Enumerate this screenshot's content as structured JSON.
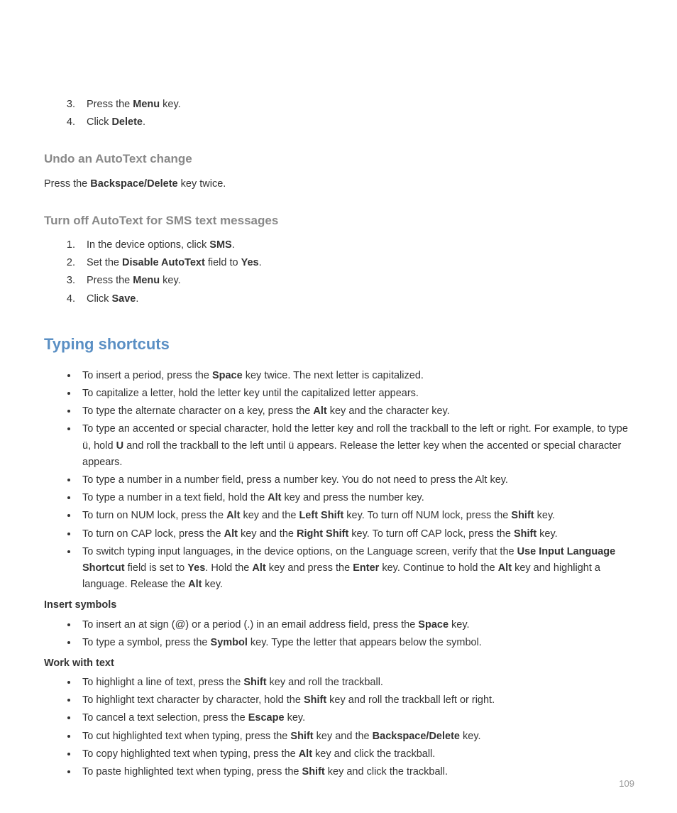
{
  "introList": {
    "start": 3,
    "items": [
      {
        "pre": "Press the ",
        "b": "Menu",
        "post": " key."
      },
      {
        "pre": "Click ",
        "b": "Delete",
        "post": "."
      }
    ]
  },
  "undo": {
    "heading": "Undo an AutoText change",
    "text_pre": "Press the ",
    "text_b": "Backspace/Delete",
    "text_post": " key twice."
  },
  "turnoff": {
    "heading": "Turn off AutoText for SMS text messages",
    "items": [
      {
        "segments": [
          {
            "t": "In the device options, click "
          },
          {
            "b": "SMS"
          },
          {
            "t": "."
          }
        ]
      },
      {
        "segments": [
          {
            "t": "Set the "
          },
          {
            "b": "Disable AutoText"
          },
          {
            "t": " field to "
          },
          {
            "b": "Yes"
          },
          {
            "t": "."
          }
        ]
      },
      {
        "segments": [
          {
            "t": "Press the "
          },
          {
            "b": "Menu"
          },
          {
            "t": " key."
          }
        ]
      },
      {
        "segments": [
          {
            "t": "Click "
          },
          {
            "b": "Save"
          },
          {
            "t": "."
          }
        ]
      }
    ]
  },
  "typing": {
    "heading": "Typing shortcuts",
    "mainList": [
      {
        "segments": [
          {
            "t": "To insert a period, press the "
          },
          {
            "b": "Space"
          },
          {
            "t": " key twice. The next letter is capitalized."
          }
        ]
      },
      {
        "segments": [
          {
            "t": "To capitalize a letter, hold the letter key until the capitalized letter appears."
          }
        ]
      },
      {
        "segments": [
          {
            "t": "To type the alternate character on a key, press the "
          },
          {
            "b": "Alt"
          },
          {
            "t": " key and the character key."
          }
        ]
      },
      {
        "segments": [
          {
            "t": "To type an accented or special character, hold the letter key and roll the trackball to the left or right. For example, to type ü, hold "
          },
          {
            "b": "U"
          },
          {
            "t": " and roll the trackball to the left until ü appears. Release the letter key when the accented or special character appears."
          }
        ]
      },
      {
        "segments": [
          {
            "t": "To type a number in a number field, press a number key. You do not need to press the Alt key."
          }
        ]
      },
      {
        "segments": [
          {
            "t": "To type a number in a text field, hold the "
          },
          {
            "b": "Alt"
          },
          {
            "t": " key and press the number key."
          }
        ]
      },
      {
        "segments": [
          {
            "t": "To turn on NUM lock, press the "
          },
          {
            "b": "Alt"
          },
          {
            "t": " key and the "
          },
          {
            "b": "Left Shift"
          },
          {
            "t": " key. To turn off NUM lock, press the "
          },
          {
            "b": "Shift"
          },
          {
            "t": " key."
          }
        ]
      },
      {
        "segments": [
          {
            "t": "To turn on CAP lock, press the "
          },
          {
            "b": "Alt"
          },
          {
            "t": " key and the "
          },
          {
            "b": "Right Shift"
          },
          {
            "t": " key. To turn off CAP lock, press the "
          },
          {
            "b": "Shift"
          },
          {
            "t": " key."
          }
        ]
      },
      {
        "segments": [
          {
            "t": "To switch typing input languages, in the device options, on the Language screen, verify that the "
          },
          {
            "b": "Use Input Language Shortcut"
          },
          {
            "t": " field is set to "
          },
          {
            "b": "Yes"
          },
          {
            "t": ". Hold the "
          },
          {
            "b": "Alt"
          },
          {
            "t": " key and press the "
          },
          {
            "b": "Enter"
          },
          {
            "t": " key. Continue to hold the "
          },
          {
            "b": "Alt"
          },
          {
            "t": " key and highlight a language. Release the "
          },
          {
            "b": "Alt"
          },
          {
            "t": " key."
          }
        ]
      }
    ],
    "insertSymbols": {
      "title": "Insert symbols",
      "items": [
        {
          "segments": [
            {
              "t": "To insert an at sign (@) or a period (.) in an email address field, press the "
            },
            {
              "b": "Space"
            },
            {
              "t": " key."
            }
          ]
        },
        {
          "segments": [
            {
              "t": "To type a symbol, press the "
            },
            {
              "b": "Symbol"
            },
            {
              "t": " key. Type the letter that appears below the symbol."
            }
          ]
        }
      ]
    },
    "workWithText": {
      "title": "Work with text",
      "items": [
        {
          "segments": [
            {
              "t": "To highlight a line of text, press the "
            },
            {
              "b": "Shift"
            },
            {
              "t": " key and roll the trackball."
            }
          ]
        },
        {
          "segments": [
            {
              "t": "To highlight text character by character, hold the "
            },
            {
              "b": "Shift"
            },
            {
              "t": " key and roll the trackball left or right."
            }
          ]
        },
        {
          "segments": [
            {
              "t": "To cancel a text selection, press the "
            },
            {
              "b": "Escape"
            },
            {
              "t": " key."
            }
          ]
        },
        {
          "segments": [
            {
              "t": "To cut highlighted text when typing, press the "
            },
            {
              "b": "Shift"
            },
            {
              "t": " key and the "
            },
            {
              "b": "Backspace/Delete"
            },
            {
              "t": " key."
            }
          ]
        },
        {
          "segments": [
            {
              "t": "To copy highlighted text when typing, press the "
            },
            {
              "b": "Alt"
            },
            {
              "t": " key and click the trackball."
            }
          ]
        },
        {
          "segments": [
            {
              "t": "To paste highlighted text when typing, press the "
            },
            {
              "b": "Shift"
            },
            {
              "t": " key and click the trackball."
            }
          ]
        }
      ]
    }
  },
  "pageNumber": "109"
}
